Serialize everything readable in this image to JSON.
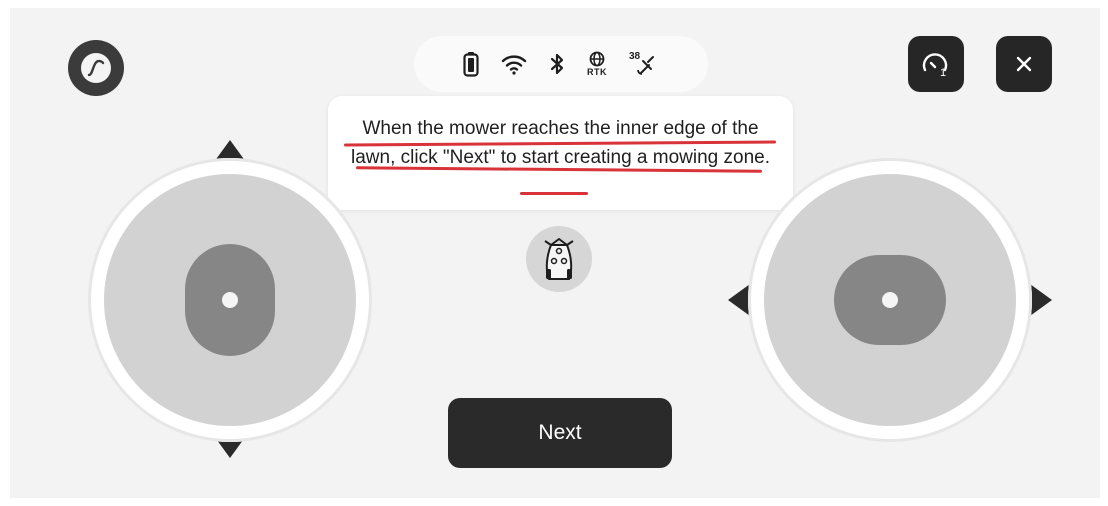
{
  "header": {
    "logo_icon": "app-logo-icon",
    "status_icons": [
      "battery-icon",
      "wifi-icon",
      "bluetooth-icon",
      "rtk-icon",
      "satellite-icon"
    ],
    "rtk_label": "RTK",
    "satellite_count": "38",
    "speed_level": "1",
    "speed_icon": "speedometer-icon",
    "close_icon": "close-icon"
  },
  "instruction": {
    "text": "When the mower reaches the inner edge of the lawn, click \"Next\" to start creating a mowing zone.",
    "annotation_color": "#d9333a"
  },
  "mower": {
    "icon": "mower-icon"
  },
  "controls": {
    "left_joystick": "forward-backward",
    "right_joystick": "left-right"
  },
  "next_button": {
    "label": "Next"
  },
  "colors": {
    "background": "#f3f3f3",
    "dark_button": "#262626",
    "accent_red": "#d9333a"
  }
}
